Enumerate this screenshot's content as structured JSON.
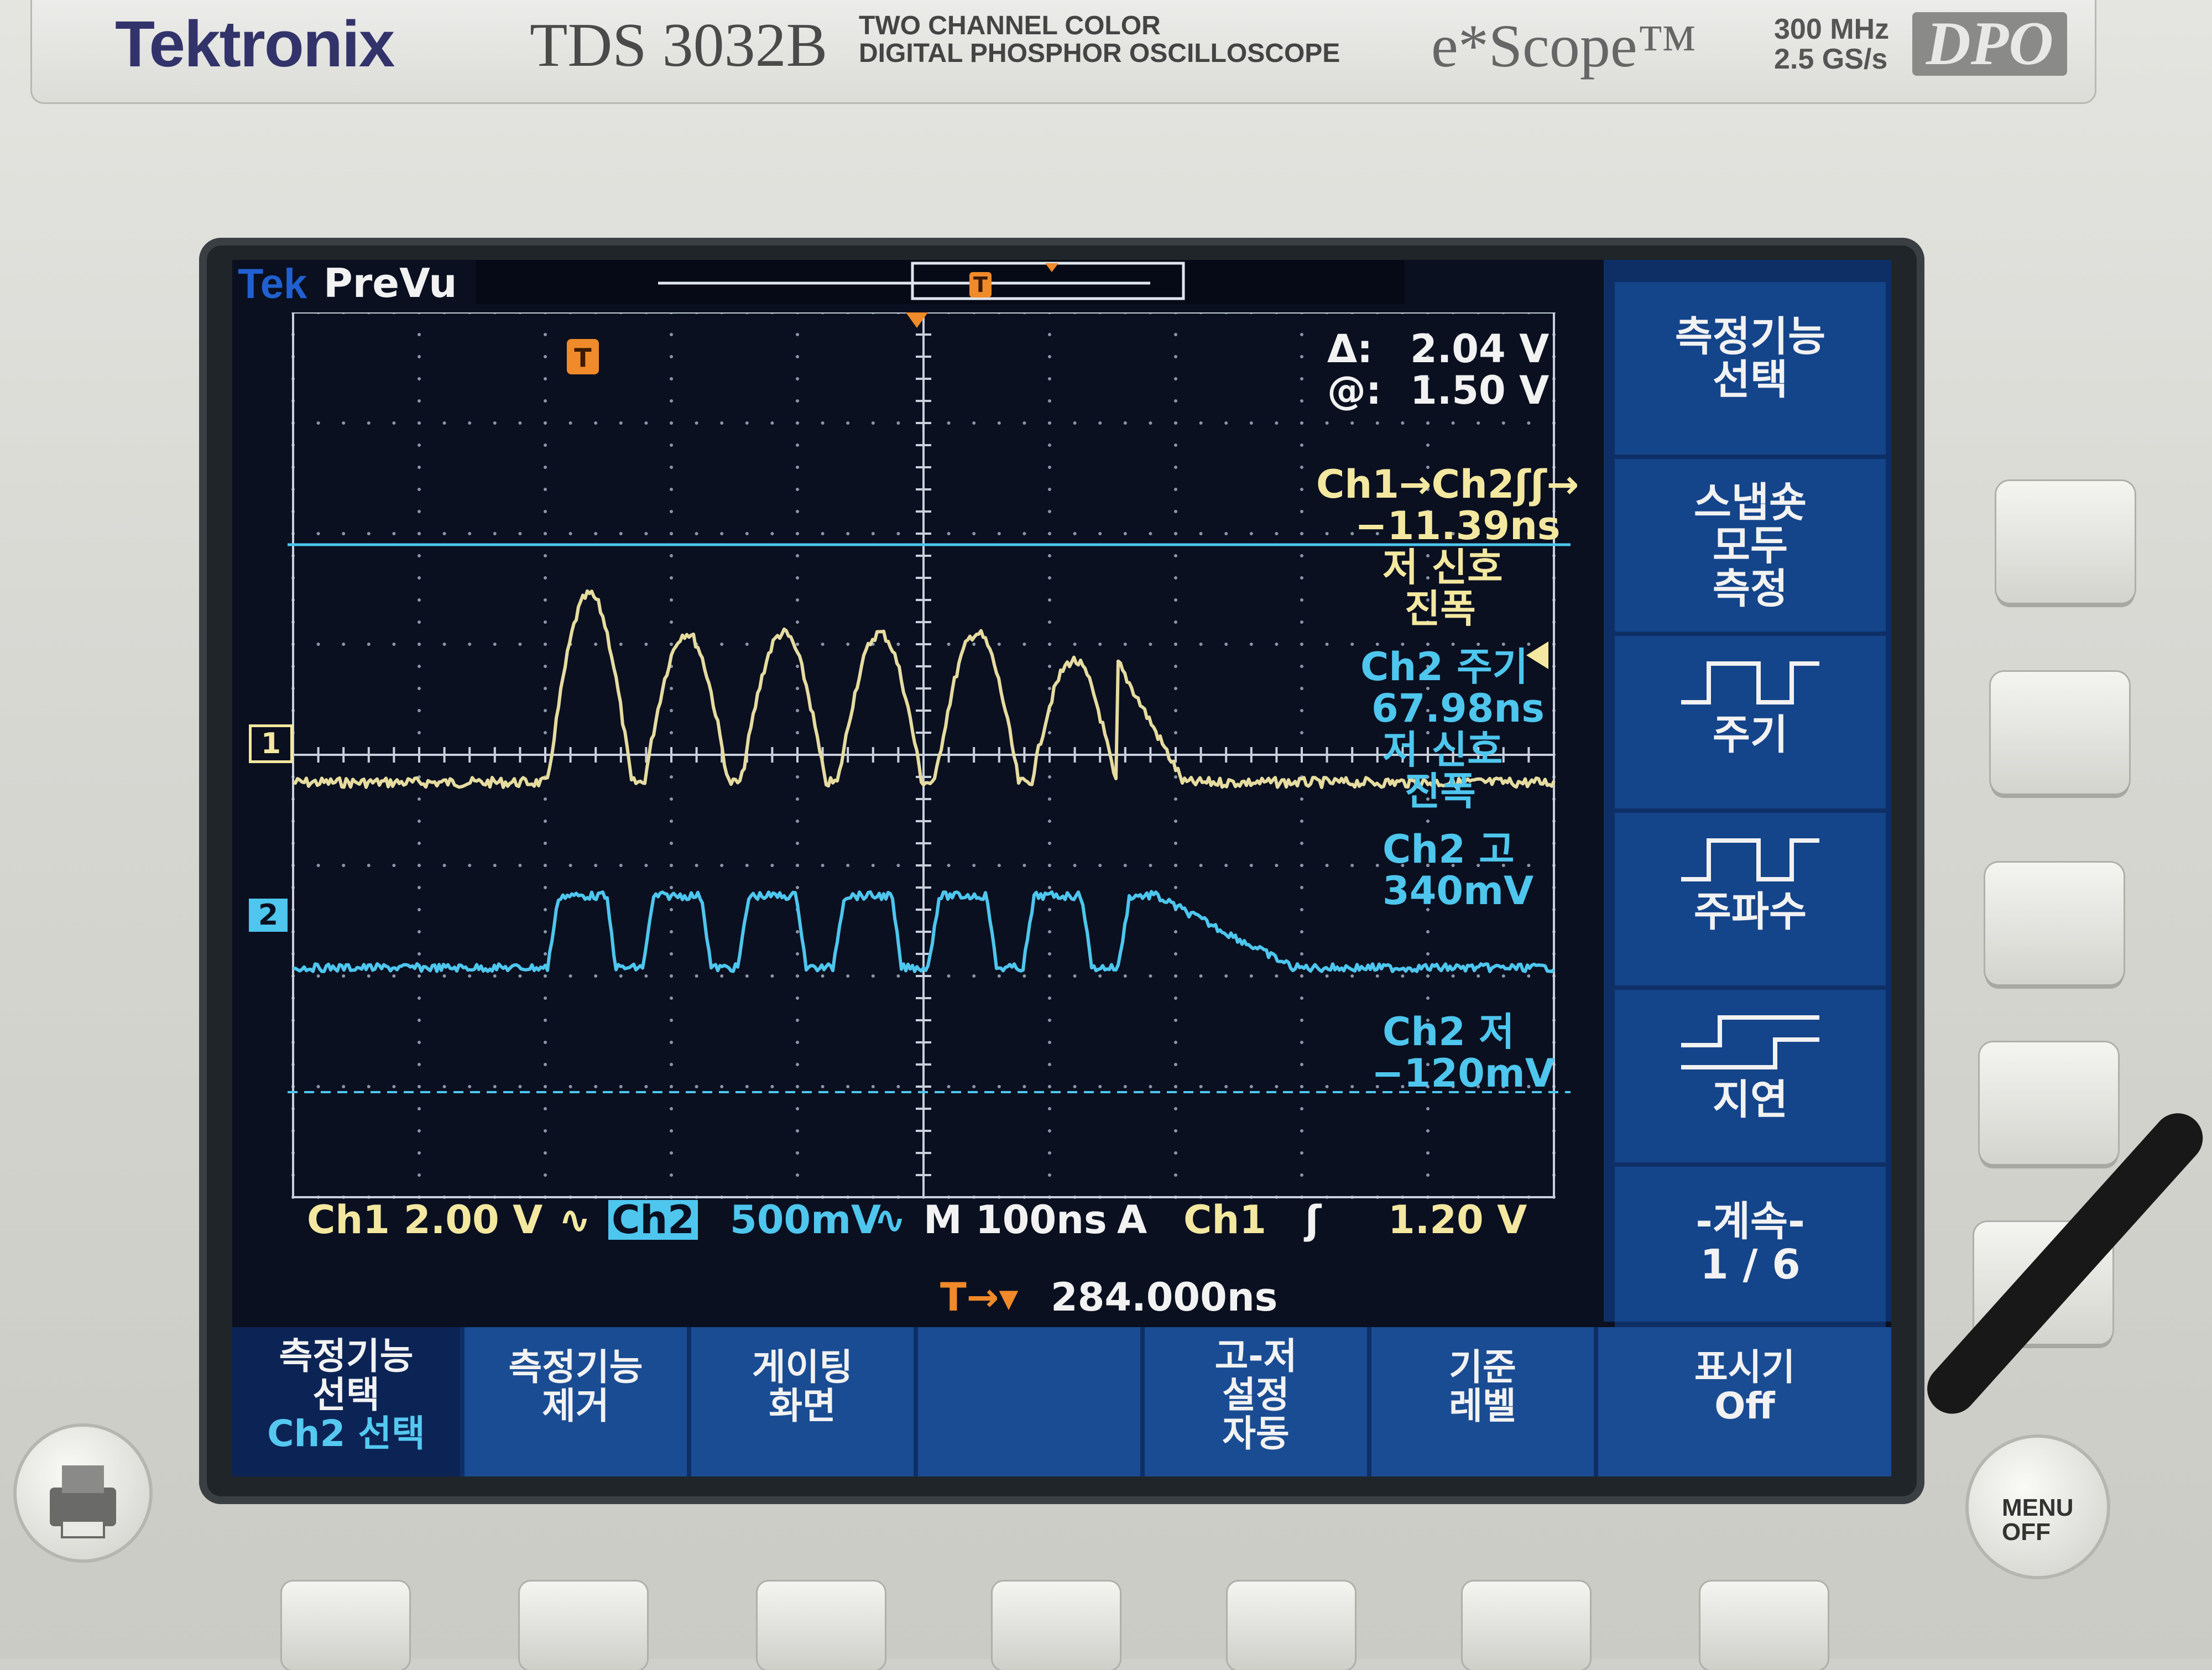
{
  "device": {
    "brand": "Tektronix",
    "model": "TDS 3032B",
    "subtitle_line1": "TWO CHANNEL COLOR",
    "subtitle_line2": "DIGITAL PHOSPHOR OSCILLOSCOPE",
    "series": "e*Scope™",
    "bandwidth": "300 MHz",
    "sample_rate": "2.5 GS/s",
    "badge": "DPO"
  },
  "status": {
    "tek": "Tek",
    "mode": "PreVu"
  },
  "markers": {
    "trigger": "T",
    "ch1": "1",
    "ch2": "2"
  },
  "cursor": {
    "delta_label": "Δ:",
    "delta_value": "2.04 V",
    "at_label": "@:",
    "at_value": "1.50 V"
  },
  "measurements": {
    "m1_label": "Ch1→Ch2ʃʃ→",
    "m1_value": "−11.39ns",
    "m1_note_a": "저 신호",
    "m1_note_b": "진폭",
    "m2_label": "Ch2 주기",
    "m2_value": "67.98ns",
    "m2_note_a": "저 신호",
    "m2_note_b": "진폭",
    "m3_label": "Ch2 고",
    "m3_value": "340mV",
    "m4_label": "Ch2 저",
    "m4_value": "−120mV"
  },
  "scale_bar": {
    "ch1_label": "Ch1",
    "ch1_scale": "2.00 V",
    "ch1_coupling": "∿",
    "ch2_label": "Ch2",
    "ch2_scale": "500mV",
    "ch2_coupling": "∿",
    "timebase": "M 100ns",
    "trig_mode": "A",
    "trig_source": "Ch1",
    "trig_slope": "ʃ",
    "trig_level": "1.20 V",
    "trig_pos_label": "T→▾",
    "trig_pos_value": "284.000ns"
  },
  "side_menu": [
    {
      "line1": "측정기능",
      "line2": "선택",
      "line3": ""
    },
    {
      "line1": "스냅숏",
      "line2": "모두",
      "line3": "측정"
    },
    {
      "line1": "주기",
      "line2": "",
      "line3": ""
    },
    {
      "line1": "주파수",
      "line2": "",
      "line3": ""
    },
    {
      "line1": "지연",
      "line2": "",
      "line3": ""
    },
    {
      "line1": "-계속-",
      "line2": "1 / 6",
      "line3": ""
    }
  ],
  "bottom_menu": [
    {
      "line1": "측정기능",
      "line2": "선택",
      "line3": "Ch2 선택"
    },
    {
      "line1": "측정기능",
      "line2": "제거",
      "line3": ""
    },
    {
      "line1": "게이팅",
      "line2": "화면",
      "line3": ""
    },
    {
      "line1": "",
      "line2": "",
      "line3": ""
    },
    {
      "line1": "고-저",
      "line2": "설정",
      "line3": "자동"
    },
    {
      "line1": "기준",
      "line2": "레벨",
      "line3": ""
    },
    {
      "line1": "표시기",
      "line2": "Off",
      "line3": ""
    }
  ],
  "buttons": {
    "menu_off": "MENU OFF"
  },
  "colors": {
    "ch1": "#f4e8a0",
    "ch2": "#4ec6ee",
    "menu_bg": "#14448a",
    "screen_bg": "#0a1020"
  }
}
